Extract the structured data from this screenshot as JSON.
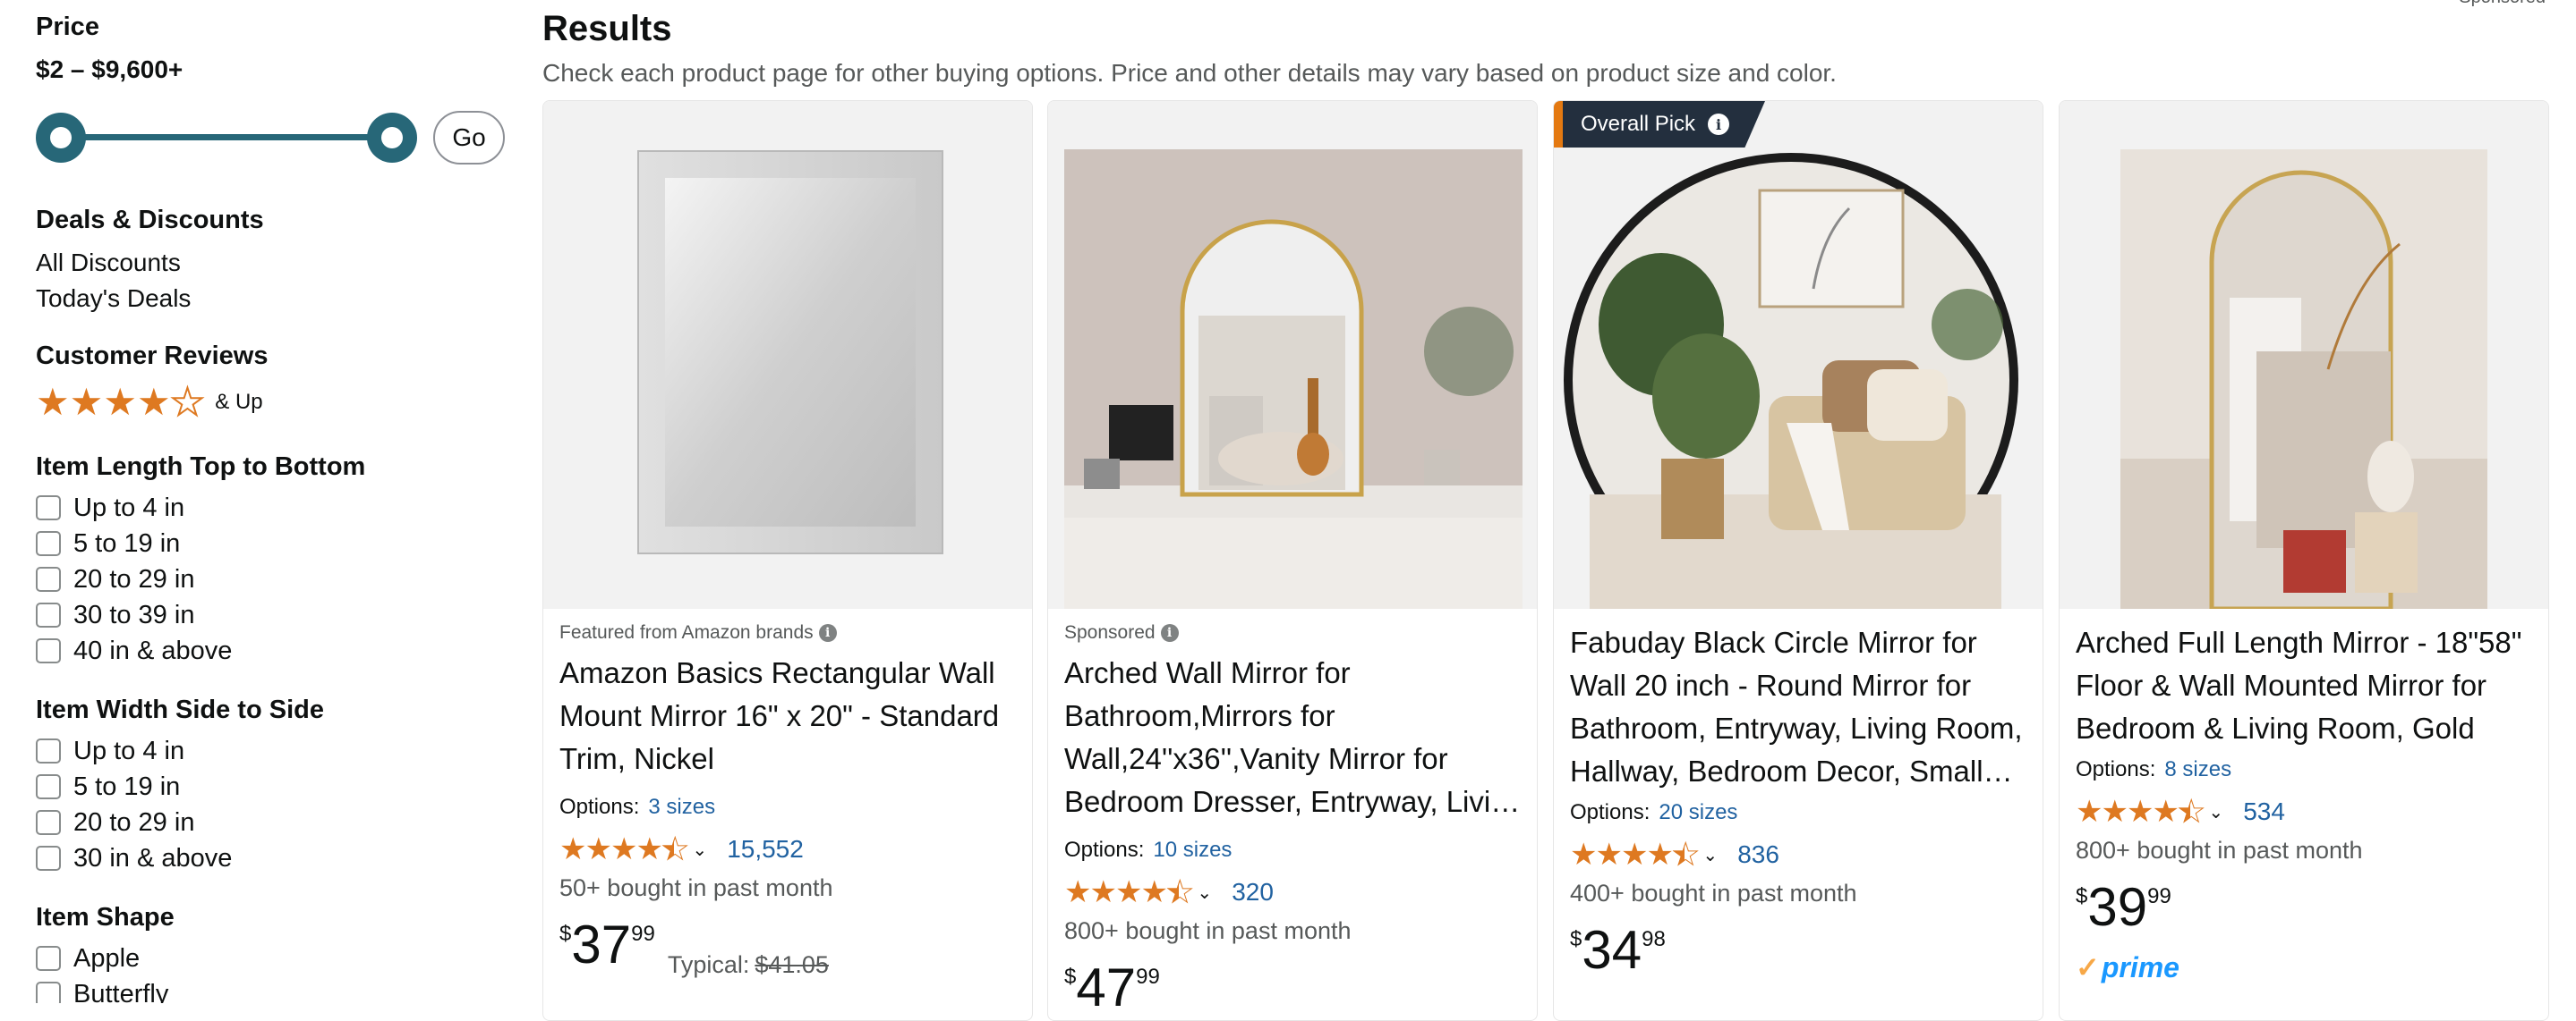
{
  "sidebar": {
    "price": {
      "heading": "Price",
      "range": "$2 – $9,600+",
      "go_label": "Go"
    },
    "deals": {
      "heading": "Deals & Discounts",
      "items": [
        "All Discounts",
        "Today's Deals"
      ]
    },
    "reviews": {
      "heading": "Customer Reviews",
      "rating_stars": 4,
      "and_up": "& Up"
    },
    "length": {
      "heading": "Item Length Top to Bottom",
      "options": [
        "Up to 4 in",
        "5 to 19 in",
        "20 to 29 in",
        "30 to 39 in",
        "40 in & above"
      ]
    },
    "width": {
      "heading": "Item Width Side to Side",
      "options": [
        "Up to 4 in",
        "5 to 19 in",
        "20 to 29 in",
        "30 in & above"
      ]
    },
    "shape": {
      "heading": "Item Shape",
      "options": [
        "Apple",
        "Butterfly"
      ]
    }
  },
  "results": {
    "title": "Results",
    "subtitle": "Check each product page for other buying options. Price and other details may vary based on product size and color.",
    "sponsored_corner": "Sponsored"
  },
  "products": [
    {
      "badge": "Featured from Amazon brands",
      "title": "Amazon Basics Rectangular Wall Mount Mirror 16\" x 20\" - Standard Trim, Nickel",
      "options_label": "Options:",
      "options_link": "3 sizes",
      "rating": 4.5,
      "reviews": "15,552",
      "bought": "50+ bought in past month",
      "price_symbol": "$",
      "price_whole": "37",
      "price_fraction": "99",
      "typical_label": "Typical:",
      "typical_price": "$41.05"
    },
    {
      "badge": "Sponsored",
      "title": "Arched Wall Mirror for Bathroom,Mirrors for Wall,24''x36'',Vanity Mirror for Bedroom Dresser, Entryway, Living Room",
      "options_label": "Options:",
      "options_link": "10 sizes",
      "rating": 4.5,
      "reviews": "320",
      "bought": "800+ bought in past month",
      "price_symbol": "$",
      "price_whole": "47",
      "price_fraction": "99"
    },
    {
      "overall_pick": "Overall Pick",
      "title": "Fabuday Black Circle Mirror for Wall 20 inch - Round Mirror for Bathroom, Entryway, Living Room, Hallway, Bedroom Decor, Small Wall Mirror",
      "options_label": "Options:",
      "options_link": "20 sizes",
      "rating": 4.5,
      "reviews": "836",
      "bought": "400+ bought in past month",
      "price_symbol": "$",
      "price_whole": "34",
      "price_fraction": "98"
    },
    {
      "title": "Arched Full Length Mirror - 18\"58\" Floor & Wall Mounted Mirror for Bedroom & Living Room, Gold",
      "options_label": "Options:",
      "options_link": "8 sizes",
      "rating": 4.5,
      "reviews": "534",
      "bought": "800+ bought in past month",
      "price_symbol": "$",
      "price_whole": "39",
      "price_fraction": "99",
      "prime": "prime"
    }
  ],
  "colors": {
    "accent_star": "#de7921",
    "link_blue": "#2162a1",
    "slider_teal": "#276778",
    "overall_pick_bg": "#232f3e",
    "prime_blue": "#1a98ff"
  }
}
